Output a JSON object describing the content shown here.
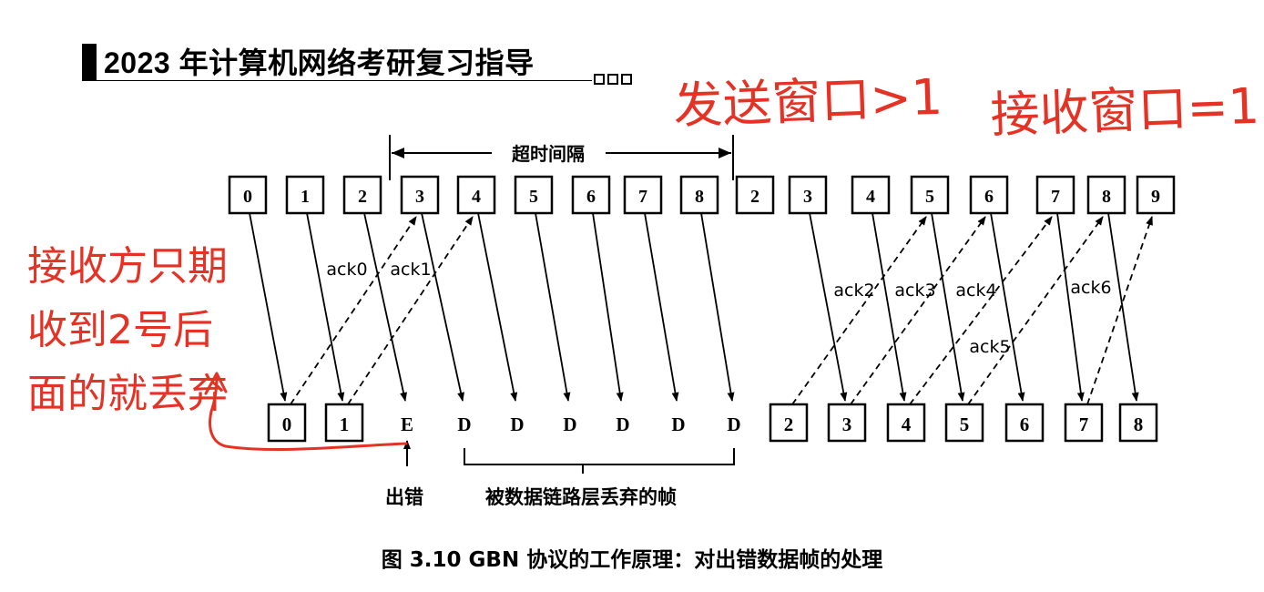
{
  "header": {
    "title": "2023 年计算机网络考研复习指导"
  },
  "diagram": {
    "timeout_label": "超时间隔",
    "sender_frames": [
      "0",
      "1",
      "2",
      "3",
      "4",
      "5",
      "6",
      "7",
      "8",
      "2",
      "3",
      "4",
      "5",
      "6",
      "7",
      "8",
      "9"
    ],
    "receiver_events": [
      "0",
      "1",
      "E",
      "D",
      "D",
      "D",
      "D",
      "D",
      "D",
      "2",
      "3",
      "4",
      "5",
      "6",
      "7",
      "8"
    ],
    "ack_labels": [
      "ack0",
      "ack1",
      "ack2",
      "ack3",
      "ack4",
      "ack5",
      "ack6"
    ],
    "error_label": "出错",
    "discard_label": "被数据链路层丢弃的帧"
  },
  "caption": "图 3.10   GBN 协议的工作原理：对出错数据帧的处理",
  "annotations": {
    "send_window": "发送窗口>1",
    "receive_window": "接收窗口=1",
    "side_note": "接收方只期收到2号后面的就丢弃"
  },
  "colors": {
    "ink": "#000000",
    "annotation": "#e53224"
  }
}
